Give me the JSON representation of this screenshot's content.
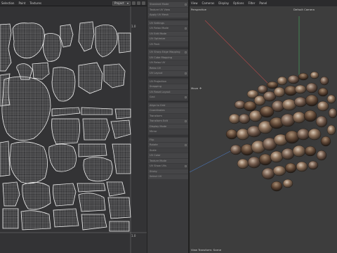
{
  "uv_editor": {
    "menu": [
      "Selection",
      "Paint",
      "Textures"
    ],
    "dropdown_value": "Project",
    "scale_top": "1.0",
    "scale_bottom": "1.0"
  },
  "list_panel": {
    "items": [
      "Standard Mode",
      "Texture UV View",
      "Apply UV Mesh",
      "UV Settings",
      "UV Relax Mode",
      "UV Edit Mode",
      "UV Optimize",
      "UV Pack",
      "UV Sharp Edge Mapping",
      "UV Cube Mapping",
      "UV Relax UV",
      "Relax UV",
      "UV Layout",
      "UV Projection",
      "Snapping",
      "UV Reset Layout",
      "Grid",
      "Align to Grid",
      "Coordinates",
      "Transform",
      "Transform Edit",
      "Display Mode",
      "Mirror",
      "Flip",
      "Rotate",
      "Scale",
      "UV Color",
      "Texture Mode",
      "UV Show UVs",
      "Sticky",
      "Select UV"
    ]
  },
  "viewport": {
    "menu": [
      "View",
      "Cameras",
      "Display",
      "Options",
      "Filter",
      "Panel"
    ],
    "camera_mode": "Perspective",
    "camera_name": "Default Camera",
    "axis_label": "Move",
    "status": "View Transform: Scene"
  },
  "colors": {
    "uv_bg": "#333335",
    "uv_wire": "#e6e6e6",
    "viewport_bg": "#3d3d3d",
    "axis_red": "#b44a4a",
    "axis_green": "#4ab464",
    "axis_blue": "#4a74b4"
  }
}
